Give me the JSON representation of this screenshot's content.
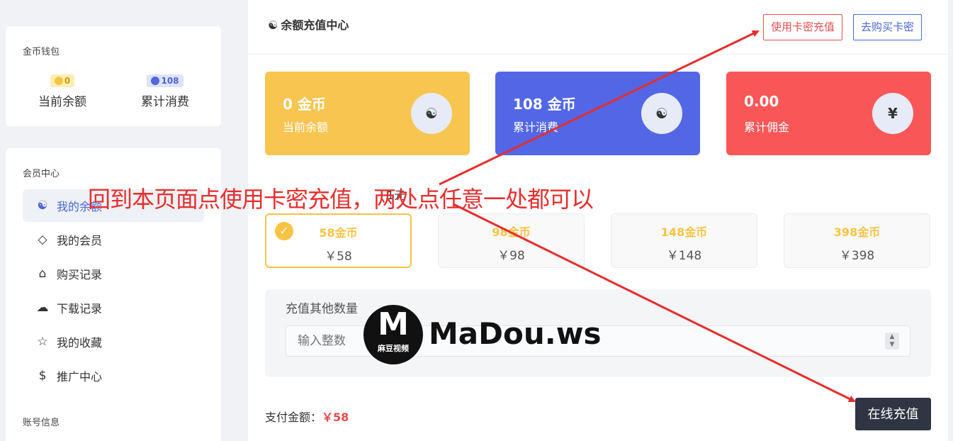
{
  "wallet": {
    "heading": "金币钱包",
    "balance_value": "0",
    "balance_label": "当前余额",
    "spent_value": "108",
    "spent_label": "累计消费"
  },
  "member": {
    "heading": "会员中心",
    "items": [
      {
        "label": "我的余额",
        "icon": "yin-yang-icon"
      },
      {
        "label": "我的会员",
        "icon": "diamond-icon"
      },
      {
        "label": "购买记录",
        "icon": "basket-icon"
      },
      {
        "label": "下载记录",
        "icon": "cloud-download-icon"
      },
      {
        "label": "我的收藏",
        "icon": "star-icon"
      },
      {
        "label": "推广中心",
        "icon": "hand-coin-icon"
      }
    ],
    "account_heading": "账号信息"
  },
  "main": {
    "title": "余额充值中心",
    "btn_use_card": "使用卡密充值",
    "btn_buy_card": "去购买卡密",
    "stats": [
      {
        "value": "0 金币",
        "label": "当前余额",
        "icon": "☯",
        "color": "#f8c551"
      },
      {
        "value": "108 金币",
        "label": "累计消费",
        "icon": "☯",
        "color": "#5367e6"
      },
      {
        "value": "0.00",
        "label": "累计佣金",
        "icon": "¥",
        "color": "#f95757"
      }
    ],
    "rate_text": "1元",
    "packages": [
      {
        "coins": "58金币",
        "price": "￥58",
        "selected": true
      },
      {
        "coins": "98金币",
        "price": "￥98",
        "selected": false
      },
      {
        "coins": "148金币",
        "price": "￥148",
        "selected": false
      },
      {
        "coins": "398金币",
        "price": "￥398",
        "selected": false
      }
    ],
    "other_label": "充值其他数量",
    "other_placeholder": "输入整数",
    "pay_label": "支付金额：",
    "pay_amount": "￥58",
    "pay_button": "在线充值"
  },
  "annotation": "回到本页面点使用卡密充值，两处点任意一处都可以",
  "watermark": {
    "logo_letter": "M",
    "logo_sub": "麻豆视频",
    "text": "MaDou.ws"
  },
  "colors": {
    "accent_yellow": "#f8c551",
    "accent_blue": "#5367e6",
    "accent_red": "#f95757",
    "annotation_red": "#e52e2e"
  }
}
